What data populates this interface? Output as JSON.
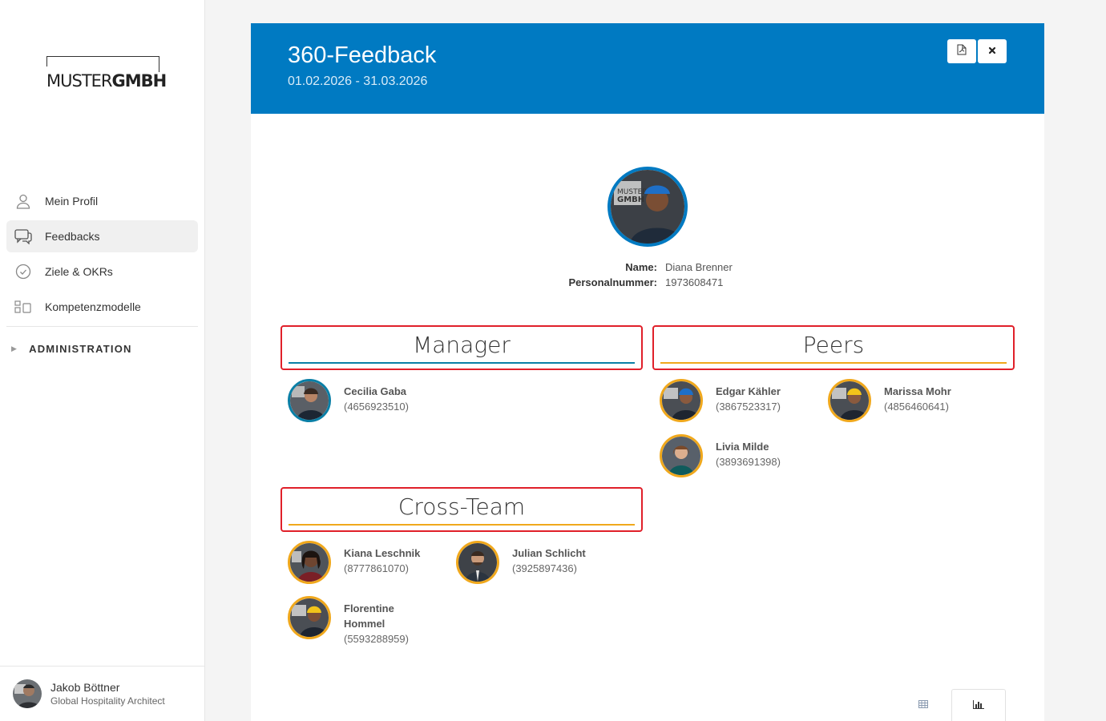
{
  "logo": {
    "part_a": "MUSTER",
    "part_b": "GMBH"
  },
  "nav": {
    "items": [
      {
        "label": "Mein Profil",
        "icon": "user-icon"
      },
      {
        "label": "Feedbacks",
        "icon": "chat-icon",
        "active": true
      },
      {
        "label": "Ziele & OKRs",
        "icon": "check-circle-icon"
      },
      {
        "label": "Kompetenzmodelle",
        "icon": "modules-icon"
      }
    ],
    "admin_label": "ADMINISTRATION"
  },
  "user": {
    "name": "Jakob Böttner",
    "role": "Global Hospitality Architect"
  },
  "header": {
    "title": "360-Feedback",
    "date_range": "01.02.2026 - 31.03.2026",
    "pdf_icon": "pdf-icon",
    "close_icon": "close-icon"
  },
  "subject": {
    "name_label": "Name:",
    "name": "Diana Brenner",
    "id_label": "Personalnummer:",
    "id": "1973608471"
  },
  "sections": {
    "manager": {
      "title": "Manager",
      "color": "#0a7fa6",
      "people": [
        {
          "name": "Cecilia Gaba",
          "id": "(4656923510)"
        }
      ]
    },
    "peers": {
      "title": "Peers",
      "color": "#f0a81c",
      "people": [
        {
          "name": "Edgar Kähler",
          "id": "(3867523317)"
        },
        {
          "name": "Marissa Mohr",
          "id": "(4856460641)"
        },
        {
          "name": "Livia Milde",
          "id": "(3893691398)"
        }
      ]
    },
    "cross_team": {
      "title": "Cross-Team",
      "color": "#f0a81c",
      "people": [
        {
          "name": "Kiana Leschnik",
          "id": "(8777861070)"
        },
        {
          "name": "Julian Schlicht",
          "id": "(3925897436)"
        },
        {
          "name": "Florentine Hommel",
          "id": "(5593288959)"
        }
      ]
    }
  },
  "view_tabs": {
    "table_icon": "table-icon",
    "chart_icon": "bar-chart-icon"
  }
}
